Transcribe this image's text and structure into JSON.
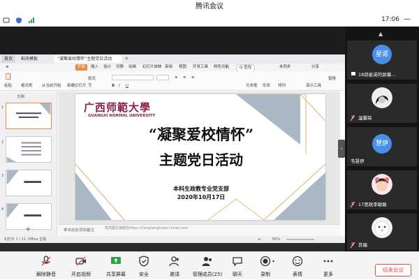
{
  "window": {
    "title": "腾讯会议"
  },
  "status": {
    "time": "17:06"
  },
  "wps": {
    "tabs": [
      "首页",
      "稻壳模板",
      "“凝聚爱校情怀”主题党日活动"
    ],
    "menu": [
      "开始",
      "插入",
      "设计",
      "切换",
      "动画",
      "幻灯片放映",
      "审阅",
      "视图",
      "开发工具",
      "特色功能"
    ],
    "search": "Q 查找",
    "collab": "未同步",
    "share": "分享",
    "tool_labels": {
      "paste": "粘贴",
      "format_brush": "格式刷",
      "from_current": "从当前开始",
      "new_slide": "新建幻灯片",
      "layout": "版式",
      "section": "节",
      "textbox": "文本框",
      "shape": "形状",
      "arrange": "排列",
      "play_tool": "演示工具",
      "replace": "替换"
    },
    "outline_tab": "大纲",
    "notes": "单击此处添加备注",
    "status_left": "幻灯片 1 / 11",
    "status_theme": "Office 主题",
    "url": "亮亮图文旗舰店https://liangliangtuwen.tmall.com",
    "zoom": "65%"
  },
  "slide": {
    "logo_text": "广西师範大學",
    "logo_sub": "GUANGXI NORMAL UNIVERSITY",
    "title_line1": "“凝聚爱校情怀”",
    "title_line2": "主题党日活动",
    "org": "本科生政教专业党支部",
    "date": "2020年10月17日"
  },
  "participants": [
    {
      "name": "18邱星诺的屏幕...",
      "avatar": "星诺",
      "avatar_color": "#4a8fe7"
    },
    {
      "name": "温馨琛"
    },
    {
      "name": "韦慧伊",
      "avatar": "慧伊",
      "avatar_color": "#4a8fe7"
    },
    {
      "name": "17思政李敏敏"
    },
    {
      "name": "苏媚"
    }
  ],
  "toolbar": [
    {
      "label": "解除静音",
      "icon": "mic-muted-icon"
    },
    {
      "label": "开启视频",
      "icon": "camera-off-icon"
    },
    {
      "label": "共享屏幕",
      "icon": "share-screen-icon"
    },
    {
      "label": "安全",
      "icon": "shield-icon"
    },
    {
      "label": "邀请",
      "icon": "invite-icon"
    },
    {
      "label": "管理成员(25)",
      "icon": "members-icon"
    },
    {
      "label": "聊天",
      "icon": "chat-icon"
    },
    {
      "label": "录制",
      "icon": "record-icon"
    },
    {
      "label": "表情",
      "icon": "emoji-icon"
    },
    {
      "label": "更多",
      "icon": "more-icon"
    }
  ],
  "end_meeting": "结束会议",
  "colors": {
    "accent": "#e54d4d",
    "slide_gray_blue": "#a9b8c4",
    "slide_gold": "#d9b26a",
    "logo_red": "#8b1f4a"
  }
}
